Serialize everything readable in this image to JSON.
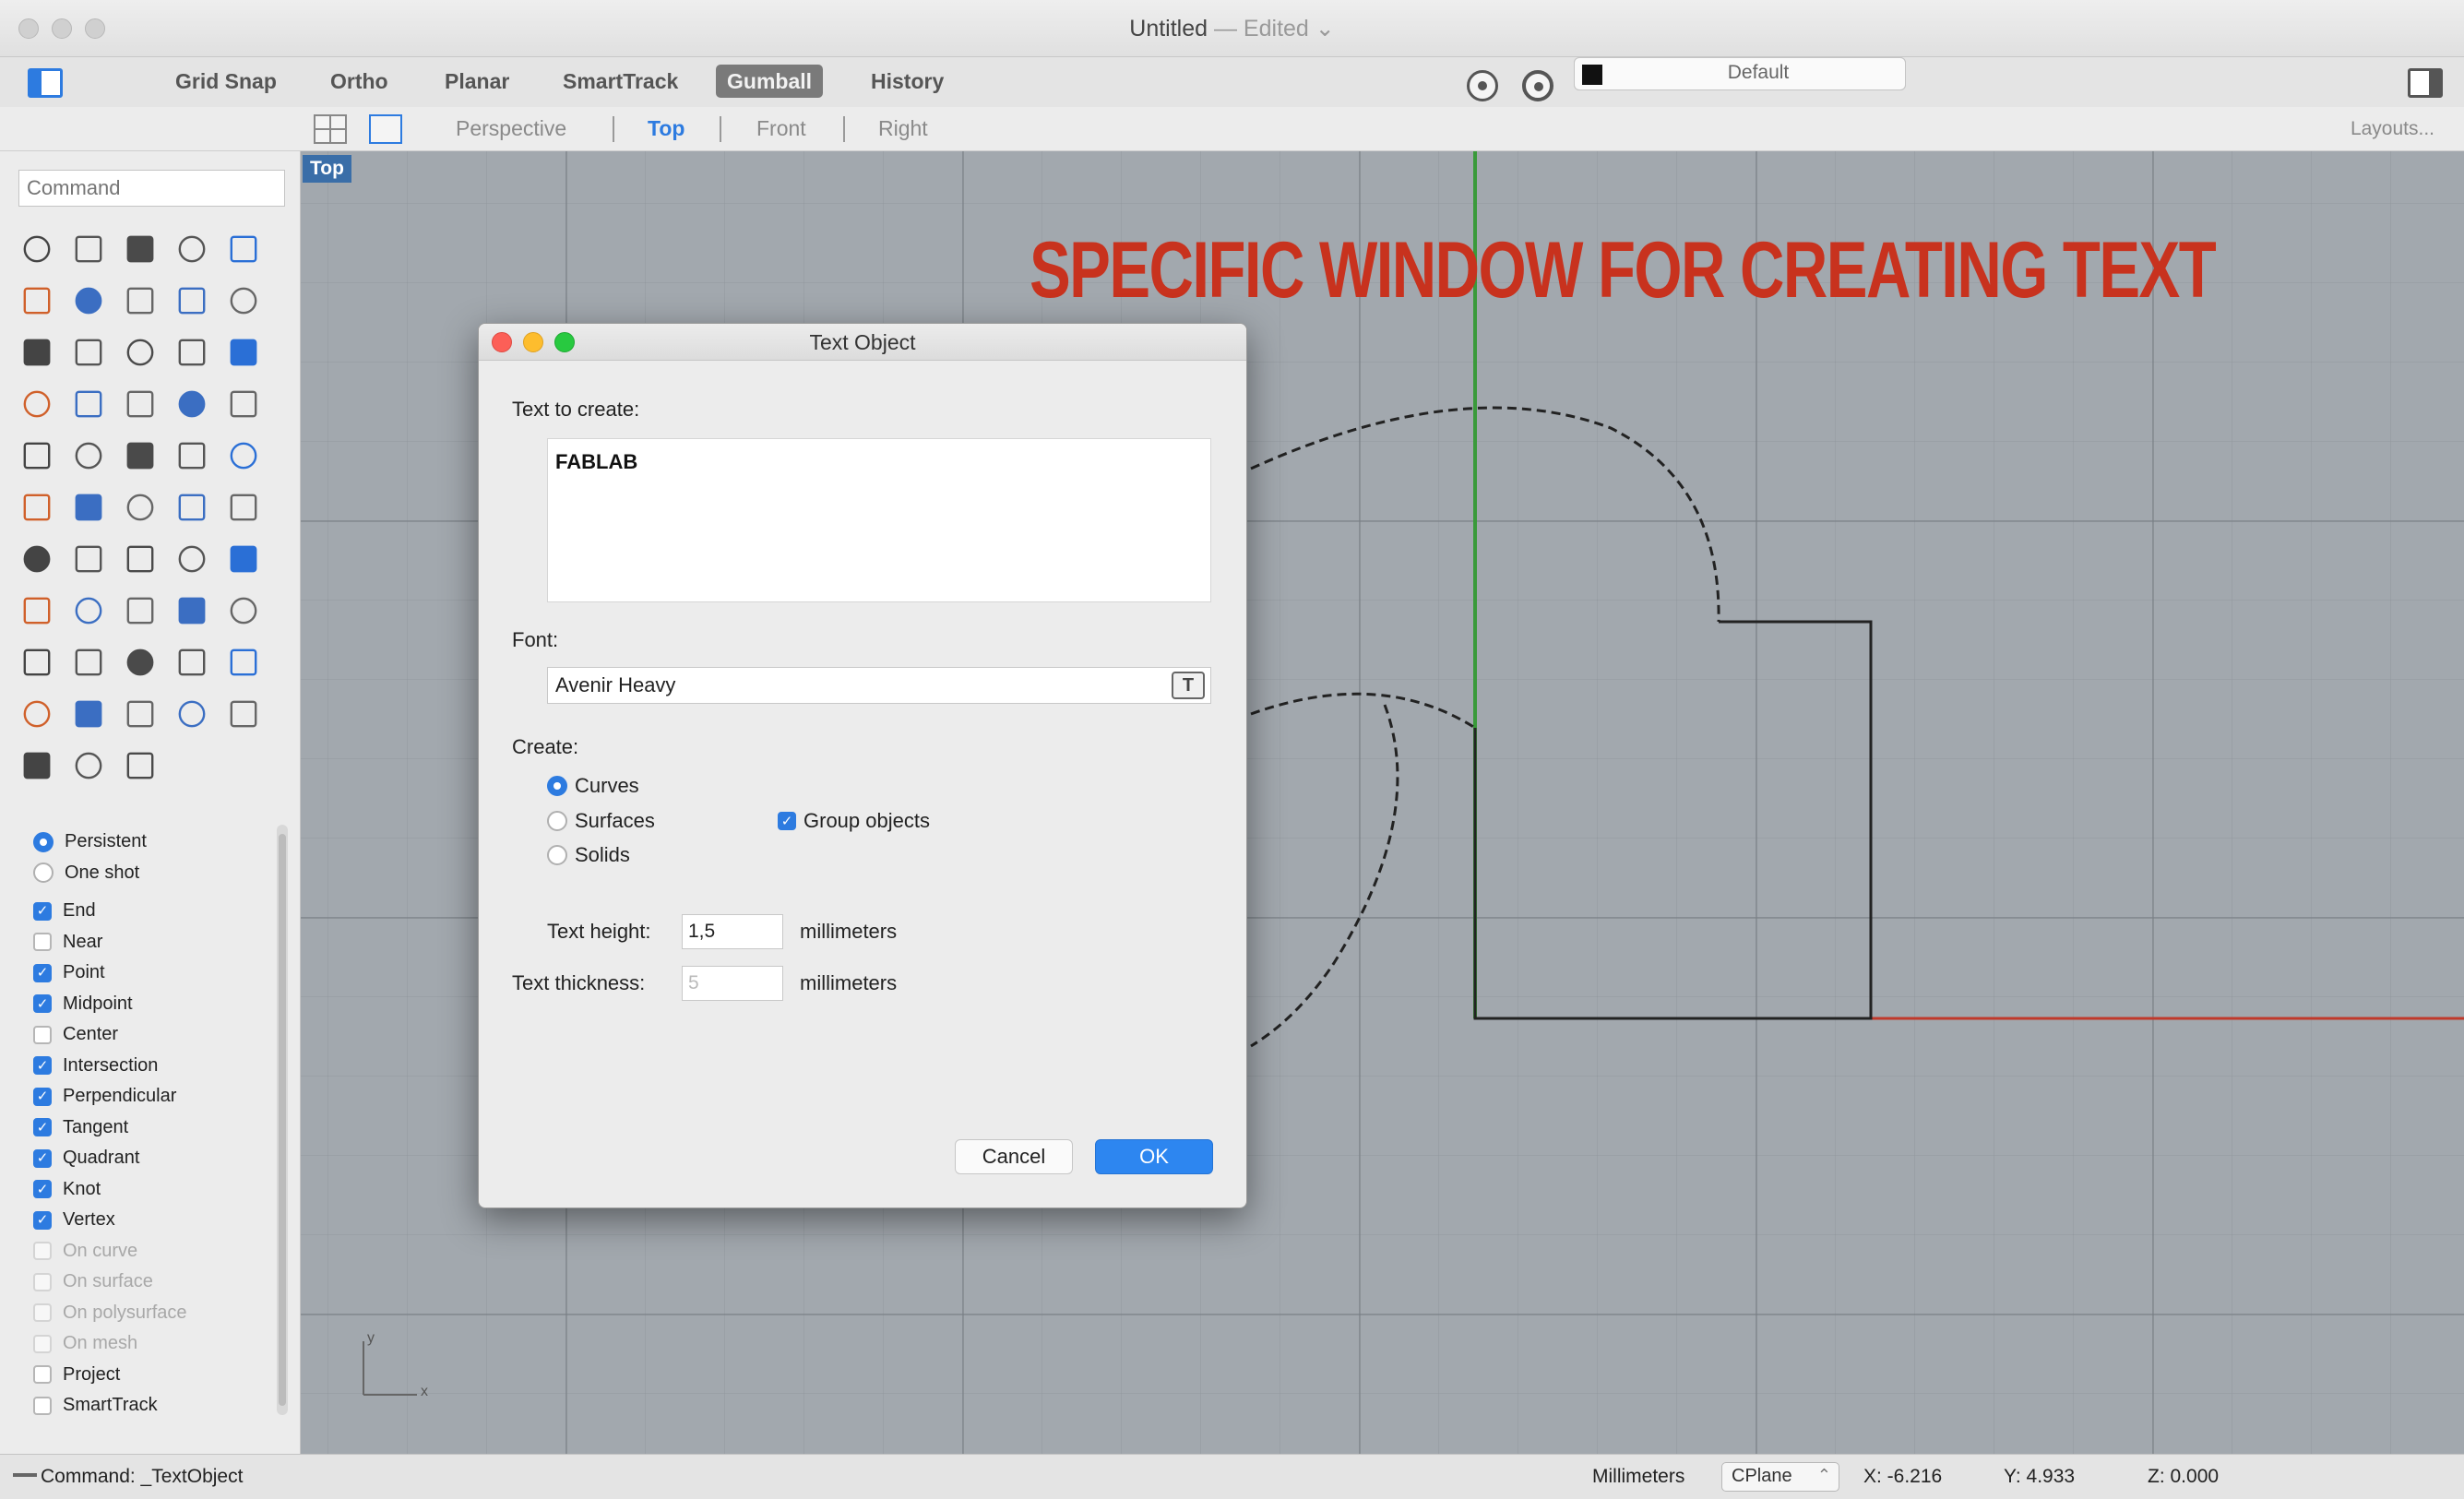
{
  "window": {
    "title": "Untitled",
    "edited": "— Edited ⌄"
  },
  "toolbar": {
    "buttons": [
      "Grid Snap",
      "Ortho",
      "Planar",
      "SmartTrack",
      "Gumball",
      "History"
    ],
    "active_button": "Gumball",
    "layer_name": "Default",
    "layer_color": "#111111"
  },
  "viewport_tabs": {
    "tabs": [
      "Perspective",
      "Top",
      "Front",
      "Right"
    ],
    "active": "Top",
    "layouts": "Layouts..."
  },
  "sidebar": {
    "command_placeholder": "Command",
    "persistence": [
      {
        "label": "Persistent",
        "selected": true
      },
      {
        "label": "One shot",
        "selected": false
      }
    ],
    "osnaps": [
      {
        "label": "End",
        "checked": true,
        "enabled": true
      },
      {
        "label": "Near",
        "checked": false,
        "enabled": true
      },
      {
        "label": "Point",
        "checked": true,
        "enabled": true
      },
      {
        "label": "Midpoint",
        "checked": true,
        "enabled": true
      },
      {
        "label": "Center",
        "checked": false,
        "enabled": true
      },
      {
        "label": "Intersection",
        "checked": true,
        "enabled": true
      },
      {
        "label": "Perpendicular",
        "checked": true,
        "enabled": true
      },
      {
        "label": "Tangent",
        "checked": true,
        "enabled": true
      },
      {
        "label": "Quadrant",
        "checked": true,
        "enabled": true
      },
      {
        "label": "Knot",
        "checked": true,
        "enabled": true
      },
      {
        "label": "Vertex",
        "checked": true,
        "enabled": true
      },
      {
        "label": "On curve",
        "checked": false,
        "enabled": false
      },
      {
        "label": "On surface",
        "checked": false,
        "enabled": false
      },
      {
        "label": "On polysurface",
        "checked": false,
        "enabled": false
      },
      {
        "label": "On mesh",
        "checked": false,
        "enabled": false
      },
      {
        "label": "Project",
        "checked": false,
        "enabled": true
      },
      {
        "label": "SmartTrack",
        "checked": false,
        "enabled": true
      }
    ]
  },
  "viewport": {
    "label": "Top",
    "axis_x": "x",
    "axis_y": "y"
  },
  "annotation": {
    "text": "SPECIFIC WINDOW FOR CREATING TEXT",
    "color": "#c8321e"
  },
  "dialog": {
    "title": "Text Object",
    "text_label": "Text to create:",
    "text_value": "FABLAB",
    "font_label": "Font:",
    "font_value": "Avenir Heavy",
    "font_button": "T",
    "create_label": "Create:",
    "create_options": [
      {
        "label": "Curves",
        "selected": true
      },
      {
        "label": "Surfaces",
        "selected": false
      },
      {
        "label": "Solids",
        "selected": false
      }
    ],
    "group_objects": {
      "label": "Group objects",
      "checked": true
    },
    "text_height_label": "Text height:",
    "text_height_value": "1,5",
    "text_height_unit": "millimeters",
    "text_thickness_label": "Text thickness:",
    "text_thickness_value": "5",
    "text_thickness_unit": "millimeters",
    "cancel_label": "Cancel",
    "ok_label": "OK"
  },
  "statusbar": {
    "command": "Command: _TextObject",
    "units": "Millimeters",
    "cplane": "CPlane",
    "x": "X: -6.216",
    "y": "Y: 4.933",
    "z": "Z: 0.000"
  },
  "colors": {
    "accent": "#2d7be0",
    "x_axis": "#c0392b",
    "y_axis": "#3a9a3a",
    "viewport_bg": "#a2a8ae"
  }
}
